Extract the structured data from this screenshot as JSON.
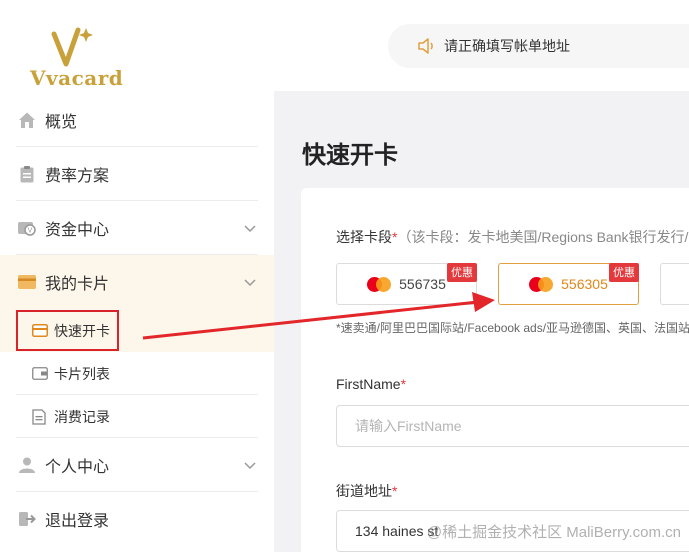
{
  "brand": {
    "logo_text": "Vvacard",
    "accent": "#c9a13a"
  },
  "notice": {
    "text": "请正确填写帐单地址"
  },
  "sidebar": {
    "items": [
      {
        "label": "概览",
        "icon": "home-icon"
      },
      {
        "label": "费率方案",
        "icon": "clipboard-icon"
      },
      {
        "label": "资金中心",
        "icon": "wallet-icon"
      },
      {
        "label": "我的卡片",
        "icon": "card-icon"
      },
      {
        "label": "个人中心",
        "icon": "user-icon"
      },
      {
        "label": "退出登录",
        "icon": "logout-icon"
      }
    ],
    "submenu": [
      {
        "label": "快速开卡",
        "icon": "card-quick-icon"
      },
      {
        "label": "卡片列表",
        "icon": "card-list-icon"
      },
      {
        "label": "消费记录",
        "icon": "receipt-icon"
      }
    ]
  },
  "main": {
    "title": "快速开卡",
    "bin_field": {
      "label": "选择卡段",
      "required": "*",
      "hint": "（该卡段：发卡地美国/Regions Bank银行发行/",
      "options": [
        {
          "bin": "556735",
          "badge": "优惠"
        },
        {
          "bin": "556305",
          "badge": "优惠"
        }
      ],
      "note": "*速卖通/阿里巴巴国际站/Facebook ads/亚马逊德国、英国、法国站"
    },
    "firstname": {
      "label": "FirstName",
      "required": "*",
      "placeholder": "请输入FirstName"
    },
    "street": {
      "label": "街道地址",
      "required": "*",
      "value": "134 haines st"
    }
  },
  "watermark": "@稀土掘金技术社区 MaliBerry.com.cn"
}
